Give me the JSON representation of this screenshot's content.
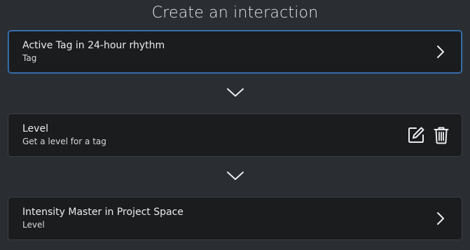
{
  "header": {
    "title": "Create an interaction"
  },
  "steps": [
    {
      "title": "Active Tag in 24-hour rhythm",
      "subtitle": "Tag",
      "state": "selected",
      "trailing_icon": "chevron-right-icon"
    },
    {
      "title": "Level",
      "subtitle": "Get a level for a tag",
      "state": "default",
      "actions": [
        "edit-icon",
        "trash-icon"
      ]
    },
    {
      "title": "Intensity Master in Project Space",
      "subtitle": "Level",
      "state": "default",
      "trailing_icon": "chevron-right-icon"
    }
  ],
  "connectors": [
    "chevron-down-icon",
    "chevron-down-icon"
  ],
  "colors": {
    "background": "#2a2e33",
    "card": "#1b1c1e",
    "card_border": "#3b3f44",
    "selected_border": "#3f7fc4",
    "text": "#e9ecef"
  }
}
